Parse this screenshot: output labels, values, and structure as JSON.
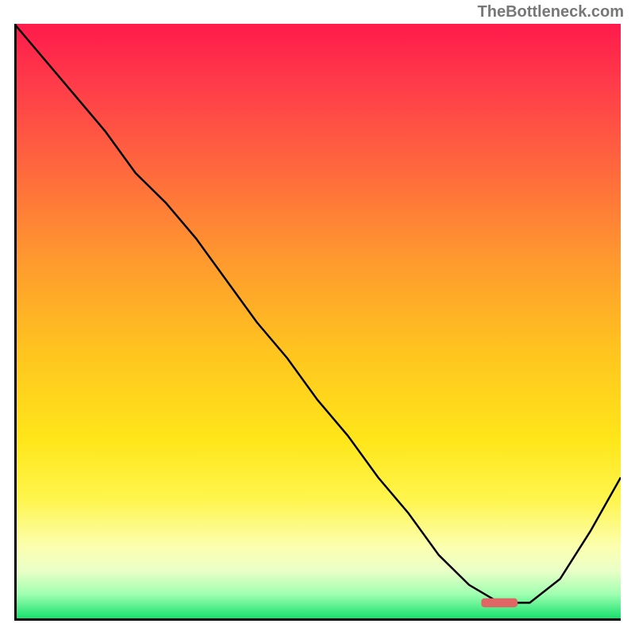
{
  "branding": {
    "watermark": "TheBottleneck.com"
  },
  "chart_data": {
    "type": "line",
    "title": "",
    "xlabel": "",
    "ylabel": "",
    "xlim": [
      0,
      100
    ],
    "ylim": [
      0,
      100
    ],
    "grid": false,
    "series": [
      {
        "name": "curve",
        "x": [
          0,
          5,
          10,
          15,
          20,
          25,
          30,
          35,
          40,
          45,
          50,
          55,
          60,
          65,
          70,
          75,
          80,
          82,
          85,
          90,
          95,
          100
        ],
        "y": [
          100,
          94,
          88,
          82,
          75,
          70,
          64,
          57,
          50,
          44,
          37,
          31,
          24,
          18,
          11,
          6,
          3,
          3,
          3,
          7,
          15,
          24
        ]
      }
    ],
    "marker": {
      "name": "optimal-marker",
      "x": 80,
      "y": 3,
      "width": 6,
      "height": 1.5,
      "color": "#e06666"
    },
    "gradient_stops": [
      {
        "offset": 0.0,
        "color": "#ff1a4b"
      },
      {
        "offset": 0.1,
        "color": "#ff3b4a"
      },
      {
        "offset": 0.25,
        "color": "#ff6a3d"
      },
      {
        "offset": 0.4,
        "color": "#ff9a2e"
      },
      {
        "offset": 0.55,
        "color": "#ffc41f"
      },
      {
        "offset": 0.7,
        "color": "#ffe61a"
      },
      {
        "offset": 0.8,
        "color": "#fff54d"
      },
      {
        "offset": 0.88,
        "color": "#fcffb0"
      },
      {
        "offset": 0.92,
        "color": "#eaffc8"
      },
      {
        "offset": 0.96,
        "color": "#9effb0"
      },
      {
        "offset": 1.0,
        "color": "#18e06e"
      }
    ]
  }
}
